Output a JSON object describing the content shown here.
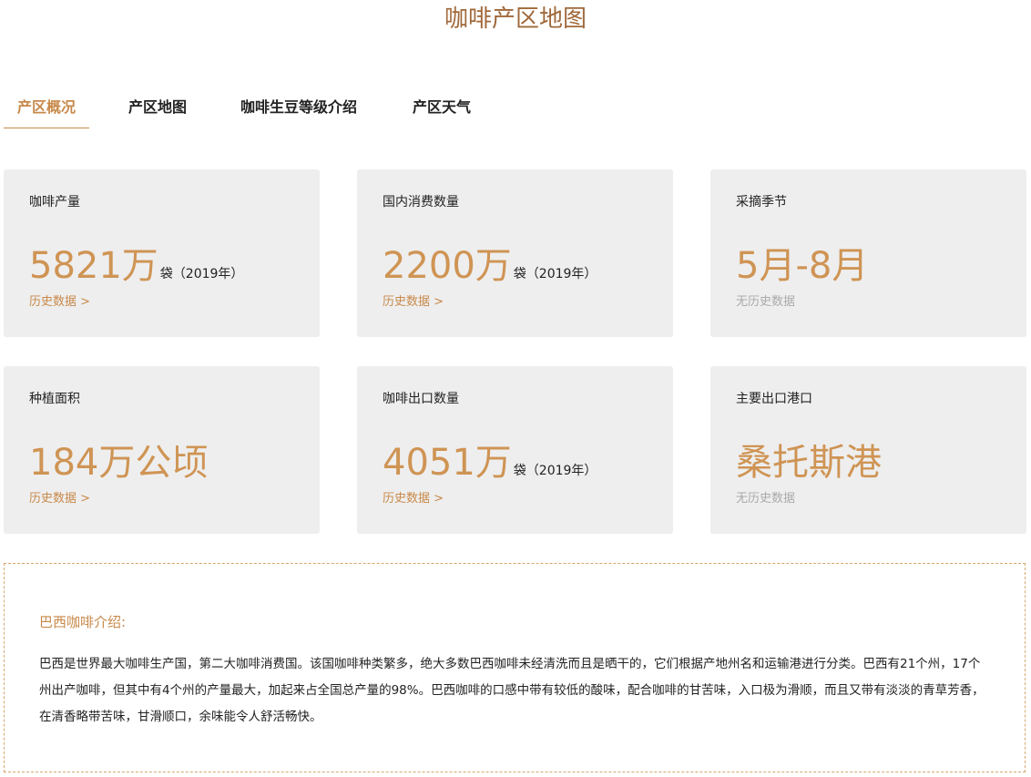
{
  "page": {
    "title": "咖啡产区地图"
  },
  "tabs": [
    {
      "label": "产区概况",
      "active": true
    },
    {
      "label": "产区地图",
      "active": false
    },
    {
      "label": "咖啡生豆等级介绍",
      "active": false
    },
    {
      "label": "产区天气",
      "active": false
    }
  ],
  "cards": [
    {
      "label": "咖啡产量",
      "value": "5821万",
      "unit": "袋（2019年）",
      "history": "历史数据 >"
    },
    {
      "label": "国内消费数量",
      "value": "2200万",
      "unit": "袋（2019年）",
      "history": "历史数据 >"
    },
    {
      "label": "采摘季节",
      "value": "5月-8月",
      "unit": "",
      "history": "无历史数据"
    },
    {
      "label": "种植面积",
      "value": "184万公顷",
      "unit": "",
      "history": "历史数据 >"
    },
    {
      "label": "咖啡出口数量",
      "value": "4051万",
      "unit": "袋（2019年）",
      "history": "历史数据 >"
    },
    {
      "label": "主要出口港口",
      "value": "桑托斯港",
      "unit": "",
      "history": "无历史数据"
    }
  ],
  "intro": {
    "title": "巴西咖啡介绍:",
    "text": "巴西是世界最大咖啡生产国，第二大咖啡消费国。该国咖啡种类繁多，绝大多数巴西咖啡未经清洗而且是晒干的，它们根据产地州名和运输港进行分类。巴西有21个州，17个州出产咖啡，但其中有4个州的产量最大，加起来占全国总产量的98%。巴西咖啡的口感中带有较低的酸味，配合咖啡的甘苦味，入口极为滑顺，而且又带有淡淡的青草芳香，在清香略带苦味，甘滑顺口，余味能令人舒活畅快。"
  },
  "colors": {
    "accent": "#c8894a",
    "title": "#a0683a",
    "card_bg": "#eeeeee",
    "muted": "#aaaaaa"
  }
}
